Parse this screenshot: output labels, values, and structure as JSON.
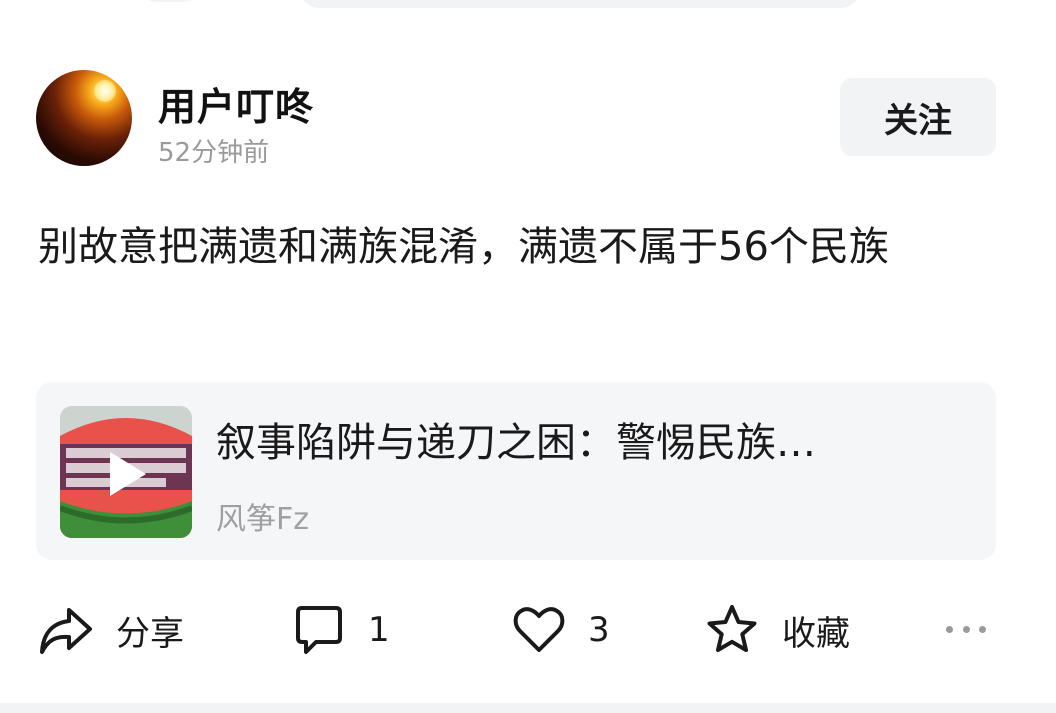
{
  "post": {
    "author": {
      "name": "用户叮咚",
      "time": "52分钟前",
      "avatar_icon": "sunset-avatar"
    },
    "follow_label": "关注",
    "text": "别故意把满遗和满族混淆，满遗不属于56个民族",
    "article": {
      "title": "叙事陷阱与递刀之困：警惕民族…",
      "source": "风筝Fz",
      "thumbnail_icon": "video-play-icon"
    },
    "actions": {
      "share_label": "分享",
      "comment_count": "1",
      "like_count": "3",
      "favorite_label": "收藏"
    }
  }
}
